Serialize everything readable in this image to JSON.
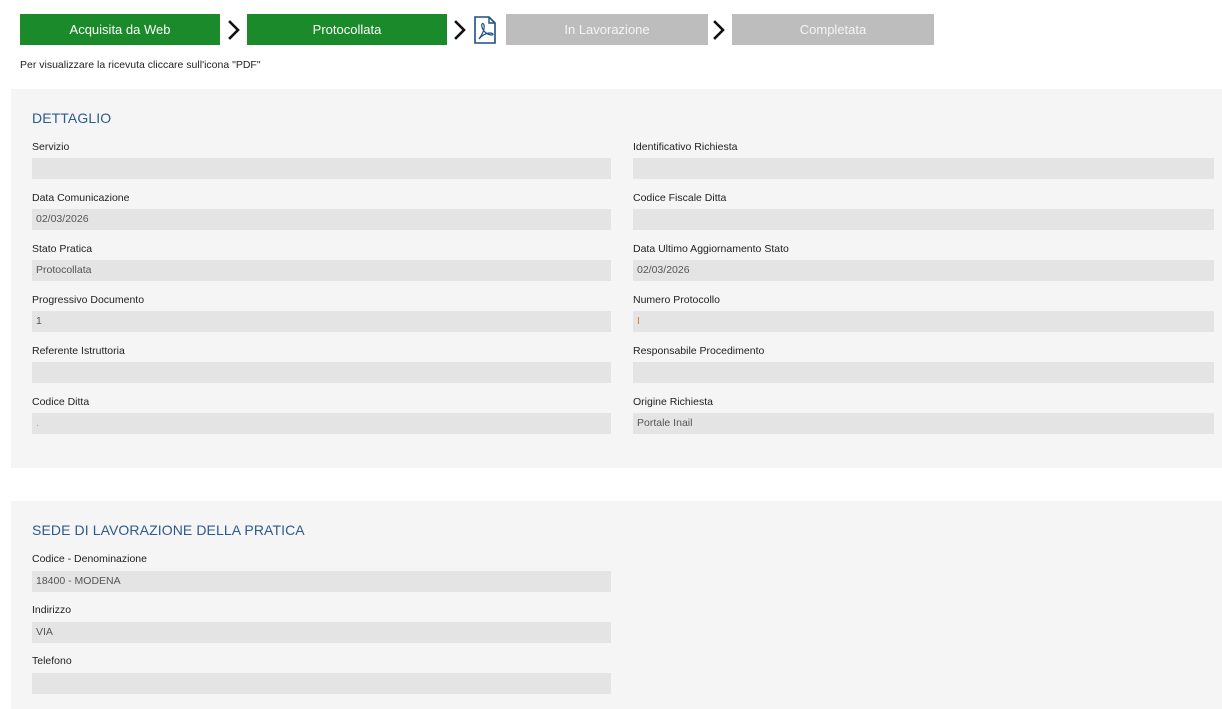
{
  "steps": {
    "step1": "Acquisita da Web",
    "step2": "Protocollata",
    "step3": "In Lavorazione",
    "step4": "Completata"
  },
  "hint": "Per visualizzare la ricevuta cliccare sull'icona \"PDF\"",
  "icons": {
    "chevron": "chevron-right-icon",
    "pdf": "pdf-icon"
  },
  "colors": {
    "step_done": "#1a8a2a",
    "step_todo": "#bdbdbd",
    "section_title": "#2e5a8c",
    "panel_bg": "#f5f5f5",
    "field_bg": "#e4e4e4"
  },
  "dettaglio": {
    "title": "DETTAGLIO",
    "servizio": {
      "label": "Servizio",
      "value": ""
    },
    "identificativo_richiesta": {
      "label": "Identificativo Richiesta",
      "value": ""
    },
    "data_comunicazione": {
      "label": "Data Comunicazione",
      "value": "02/03/2026"
    },
    "codice_fiscale_ditta": {
      "label": "Codice Fiscale Ditta",
      "value": ""
    },
    "stato_pratica": {
      "label": "Stato Pratica",
      "value": "Protocollata"
    },
    "data_ultimo_aggiornamento": {
      "label": "Data Ultimo Aggiornamento Stato",
      "value": "02/03/2026"
    },
    "progressivo_documento": {
      "label": "Progressivo Documento",
      "value": "1"
    },
    "numero_protocollo": {
      "label": "Numero Protocollo",
      "value": "I"
    },
    "referente_istruttoria": {
      "label": "Referente Istruttoria",
      "value": ""
    },
    "responsabile_procedimento": {
      "label": "Responsabile Procedimento",
      "value": ""
    },
    "codice_ditta": {
      "label": "Codice Ditta",
      "value": "."
    },
    "origine_richiesta": {
      "label": "Origine Richiesta",
      "value": "Portale Inail"
    }
  },
  "sede": {
    "title": "SEDE DI LAVORAZIONE DELLA PRATICA",
    "codice_denominazione": {
      "label": "Codice - Denominazione",
      "value": "18400 - MODENA"
    },
    "indirizzo": {
      "label": "Indirizzo",
      "value": "VIA"
    },
    "telefono": {
      "label": "Telefono",
      "value": ""
    }
  }
}
